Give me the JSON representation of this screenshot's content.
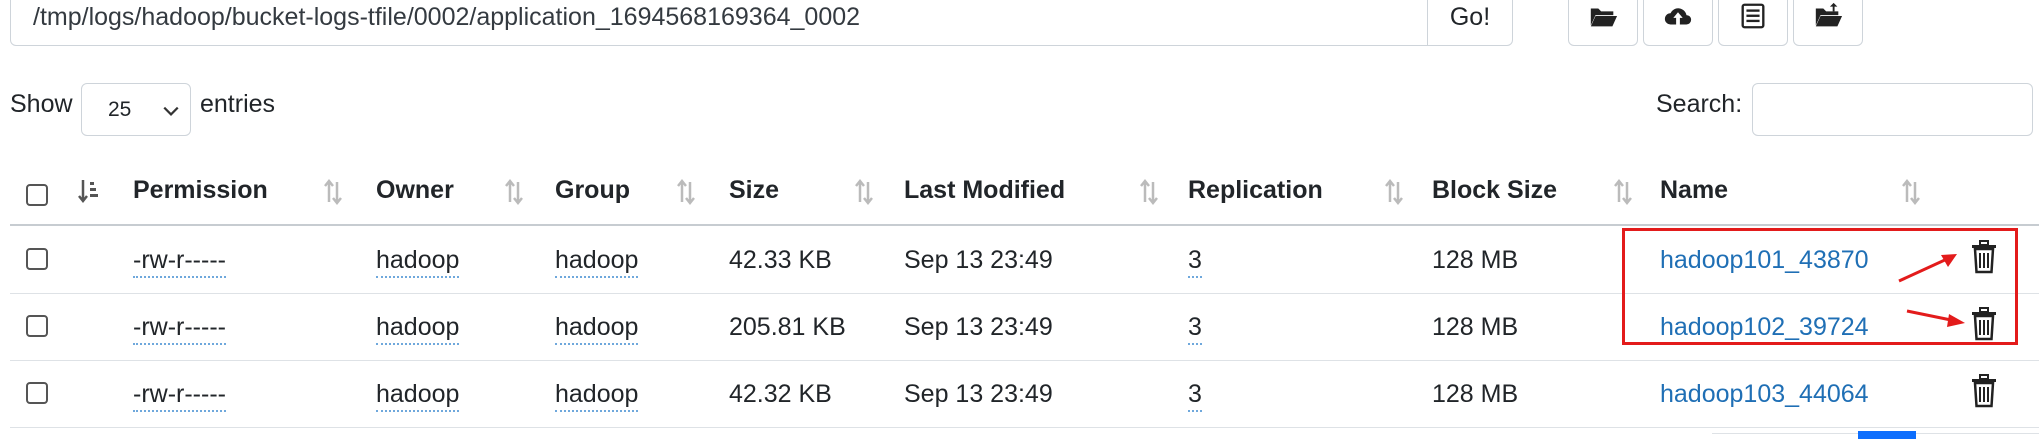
{
  "path": {
    "value": "/tmp/logs/hadoop/bucket-logs-tfile/0002/application_1694568169364_0002",
    "go_label": "Go!"
  },
  "toolbar": {
    "icons": [
      "folder-open-icon",
      "cloud-upload-icon",
      "list-icon",
      "folder-upload-icon"
    ]
  },
  "length": {
    "show_label": "Show",
    "value": "25",
    "entries_label": "entries"
  },
  "search": {
    "label": "Search:",
    "value": ""
  },
  "table": {
    "columns": [
      "Permission",
      "Owner",
      "Group",
      "Size",
      "Last Modified",
      "Replication",
      "Block Size",
      "Name"
    ],
    "rows": [
      {
        "permission": "-rw-r-----",
        "owner": "hadoop",
        "group": "hadoop",
        "size": "42.33 KB",
        "modified": "Sep 13 23:49",
        "replication": "3",
        "block_size": "128 MB",
        "name": "hadoop101_43870"
      },
      {
        "permission": "-rw-r-----",
        "owner": "hadoop",
        "group": "hadoop",
        "size": "205.81 KB",
        "modified": "Sep 13 23:49",
        "replication": "3",
        "block_size": "128 MB",
        "name": "hadoop102_39724"
      },
      {
        "permission": "-rw-r-----",
        "owner": "hadoop",
        "group": "hadoop",
        "size": "42.32 KB",
        "modified": "Sep 13 23:49",
        "replication": "3",
        "block_size": "128 MB",
        "name": "hadoop103_44064"
      }
    ]
  },
  "colors": {
    "link": "#1f6fb5",
    "annotation": "#e31b1b",
    "border": "#ced4da"
  }
}
